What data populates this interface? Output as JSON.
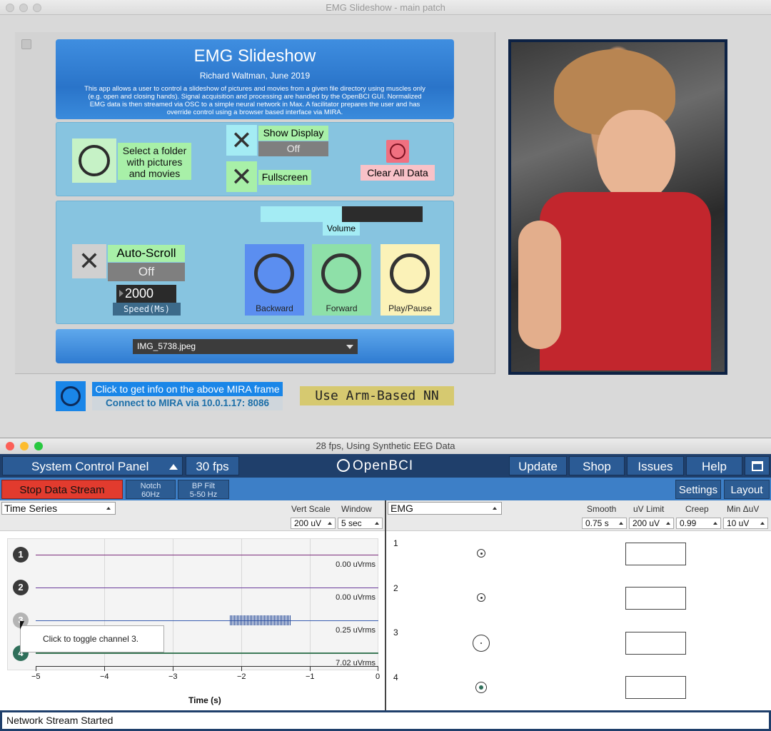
{
  "max_window": {
    "title": "EMG Slideshow - main patch",
    "header": {
      "title": "EMG Slideshow",
      "author": "Richard Waltman, June 2019",
      "description": "This app allows a user to control a slideshow of pictures and movies from a given file directory using muscles only (e.g. open and closing hands). Signal acquisition and processing are handled by the OpenBCI GUI. Normalized EMG data is then streamed via OSC to a simple neural network in Max. A facilitator prepares the user and has override control using a browser based interface via MIRA."
    },
    "controls": {
      "select_folder_label": "Select a folder with pictures and movies",
      "show_display_label": "Show Display",
      "show_display_value": "Off",
      "fullscreen_label": "Fullscreen",
      "clear_all_label": "Clear All Data",
      "volume_label": "Volume",
      "volume_level": 0.5,
      "auto_scroll_label": "Auto-Scroll",
      "auto_scroll_value": "Off",
      "speed_value": "2000",
      "speed_label": "Speed(Ms)",
      "backward_label": "Backward",
      "forward_label": "Forward",
      "play_pause_label": "Play/Pause",
      "image_file": "IMG_5738.jpeg"
    },
    "mira": {
      "info": "Click to get info on the above MIRA frame",
      "connect": "Connect to MIRA via 10.0.1.17: 8086"
    },
    "arm_nn_label": "Use Arm-Based NN",
    "colors": {
      "green": "#a8f0a8",
      "cyan": "#a4ecf4",
      "blue_button": "#5b8ef0",
      "forward_button": "#8ee0a8",
      "play_button": "#fbf2b8"
    }
  },
  "bci_window": {
    "title": "28 fps, Using Synthetic EEG Data",
    "topbar": {
      "panel_label": "System Control Panel",
      "fps": "30 fps",
      "logo": "OpenBCI",
      "update": "Update",
      "shop": "Shop",
      "issues": "Issues",
      "help": "Help"
    },
    "subbar": {
      "stop": "Stop Data Stream",
      "notch_line1": "Notch",
      "notch_line2": "60Hz",
      "bp_line1": "BP Filt",
      "bp_line2": "5-50 Hz",
      "settings": "Settings",
      "layout": "Layout"
    },
    "time_series": {
      "widget": "Time Series",
      "vert_scale_label": "Vert Scale",
      "window_label": "Window",
      "vert_scale": "200 uV",
      "window": "5 sec",
      "channels": [
        {
          "num": "1",
          "rms": "0.00 uVrms",
          "color": "#3a3a3a"
        },
        {
          "num": "2",
          "rms": "0.00 uVrms",
          "color": "#3a3a3a"
        },
        {
          "num": "3",
          "rms": "0.25 uVrms",
          "color": "#b4b4b4"
        },
        {
          "num": "4",
          "rms": "7.02 uVrms",
          "color": "#2f6f5a"
        }
      ],
      "x_ticks": [
        "−5",
        "−4",
        "−3",
        "−2",
        "−1",
        "0"
      ],
      "x_label": "Time (s)",
      "tooltip": "Click to toggle channel 3."
    },
    "emg": {
      "widget": "EMG",
      "smooth_label": "Smooth",
      "uv_limit_label": "uV Limit",
      "creep_label": "Creep",
      "min_label": "Min ΔuV",
      "smooth": "0.75 s",
      "uv_limit": "200 uV",
      "creep": "0.99",
      "min": "10 uV",
      "channels": [
        "1",
        "2",
        "3",
        "4"
      ]
    },
    "status": "Network Stream Started"
  }
}
